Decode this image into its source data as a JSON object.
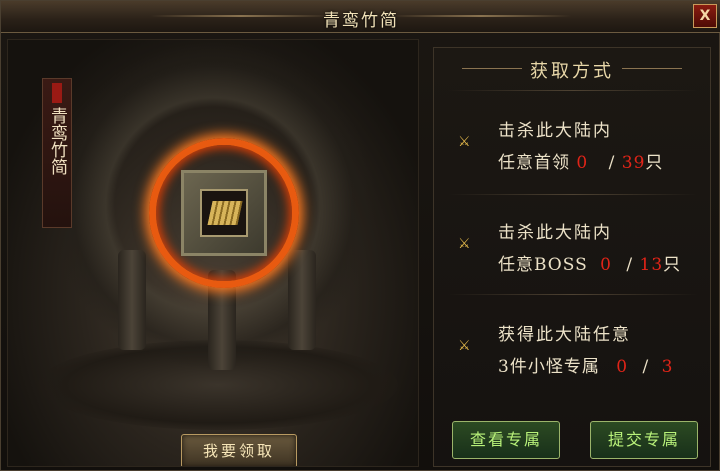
{
  "window": {
    "title": "青鸾竹简",
    "close_label": "X"
  },
  "left_panel": {
    "vertical_title": "青鸾竹简",
    "claim_button": "我要领取",
    "item_icon": "bamboo-scroll-icon"
  },
  "right_panel": {
    "header": "获取方式",
    "tasks": [
      {
        "line1": "击杀此大陆内",
        "prefix": "任意首领",
        "current": "0",
        "separator": "/",
        "target": "39",
        "unit": "只"
      },
      {
        "line1": "击杀此大陆内",
        "prefix": "任意BOSS",
        "current": "0",
        "separator": "/",
        "target": "13",
        "unit": "只"
      },
      {
        "line1": "获得此大陆任意",
        "prefix": "3件小怪专属",
        "current": "0",
        "separator": "/",
        "target": "3",
        "unit": ""
      }
    ],
    "view_button": "查看专属",
    "submit_button": "提交专属"
  },
  "colors": {
    "accent_red": "#e02418",
    "ring_orange": "#e85a10",
    "button_green_text": "#b9f27a"
  }
}
